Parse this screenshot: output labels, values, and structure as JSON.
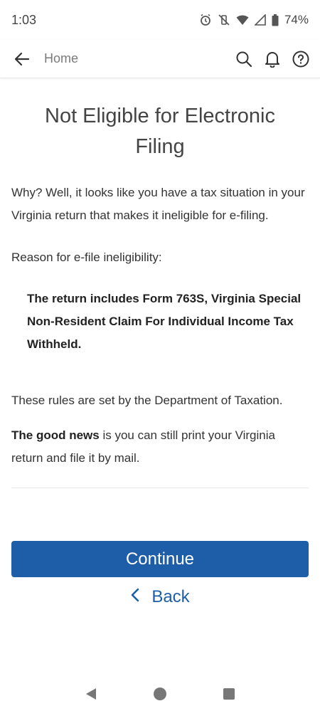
{
  "status_bar": {
    "time": "1:03",
    "battery": "74%"
  },
  "app_bar": {
    "home_label": "Home"
  },
  "page": {
    "title": "Not Eligible for Electronic Filing",
    "intro": "Why? Well, it looks like you have a tax situation in your Virginia return that makes it ineligible for e-filing.",
    "reason_label": "Reason for e-file ineligibility:",
    "reason_detail": "The return includes Form 763S, Virginia Special Non-Resident Claim For Individual Income Tax Withheld.",
    "rules": "These rules are set by the Department of Taxation.",
    "good_news_bold": "The good news",
    "good_news_rest": " is you can still print your Virginia return and file it by mail."
  },
  "actions": {
    "continue_label": "Continue",
    "back_label": "Back"
  },
  "colors": {
    "accent": "#1e5ea8"
  }
}
